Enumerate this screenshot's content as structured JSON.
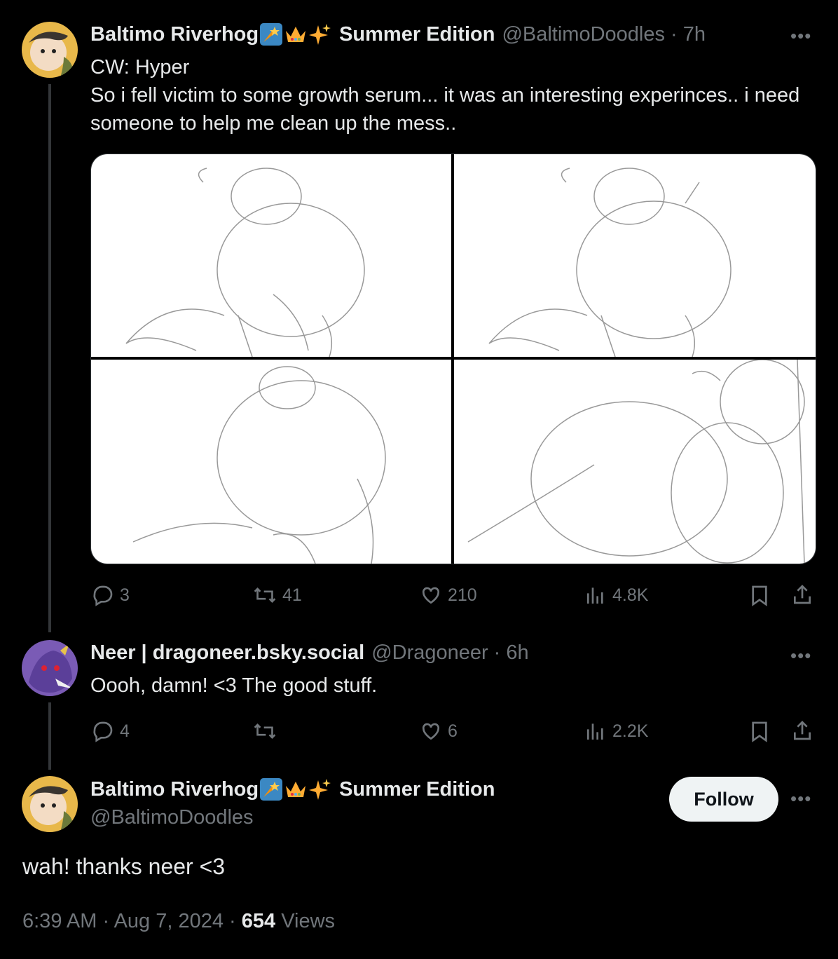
{
  "tweet1": {
    "display_name": "Baltimo Riverhog",
    "edition": "Summer Edition",
    "handle": "@BaltimoDoodles",
    "time": "· 7h",
    "cw_line": "CW: Hyper",
    "body": "So i fell victim to some growth serum... it was an interesting experinces.. i need someone to help me clean up the mess..",
    "replies": "3",
    "retweets": "41",
    "likes": "210",
    "views": "4.8K"
  },
  "tweet2": {
    "display_name": "Neer | dragoneer.bsky.social",
    "handle": "@Dragoneer",
    "time": "· 6h",
    "body": "Oooh, damn! <3 The good stuff.",
    "replies": "4",
    "retweets": "",
    "likes": "6",
    "views": "2.2K"
  },
  "main": {
    "display_name": "Baltimo Riverhog",
    "edition": "Summer Edition",
    "handle": "@BaltimoDoodles",
    "follow_label": "Follow",
    "body": "wah! thanks neer <3",
    "timestamp": "6:39 AM · Aug 7, 2024 · ",
    "view_count": "654",
    "views_label": " Views"
  },
  "icons": {
    "more": "more-horizontal-icon",
    "reply": "reply-icon",
    "retweet": "retweet-icon",
    "like": "heart-icon",
    "views": "bar-chart-icon",
    "bookmark": "bookmark-icon",
    "share": "share-icon",
    "emoji_1": "shooting-star-emoji",
    "emoji_2": "crown-emoji",
    "emoji_3": "sparkles-emoji"
  },
  "colors": {
    "background": "#000000",
    "text": "#e7e9ea",
    "muted": "#71767b",
    "thread_line": "#333639",
    "follow_bg": "#eff3f4"
  }
}
